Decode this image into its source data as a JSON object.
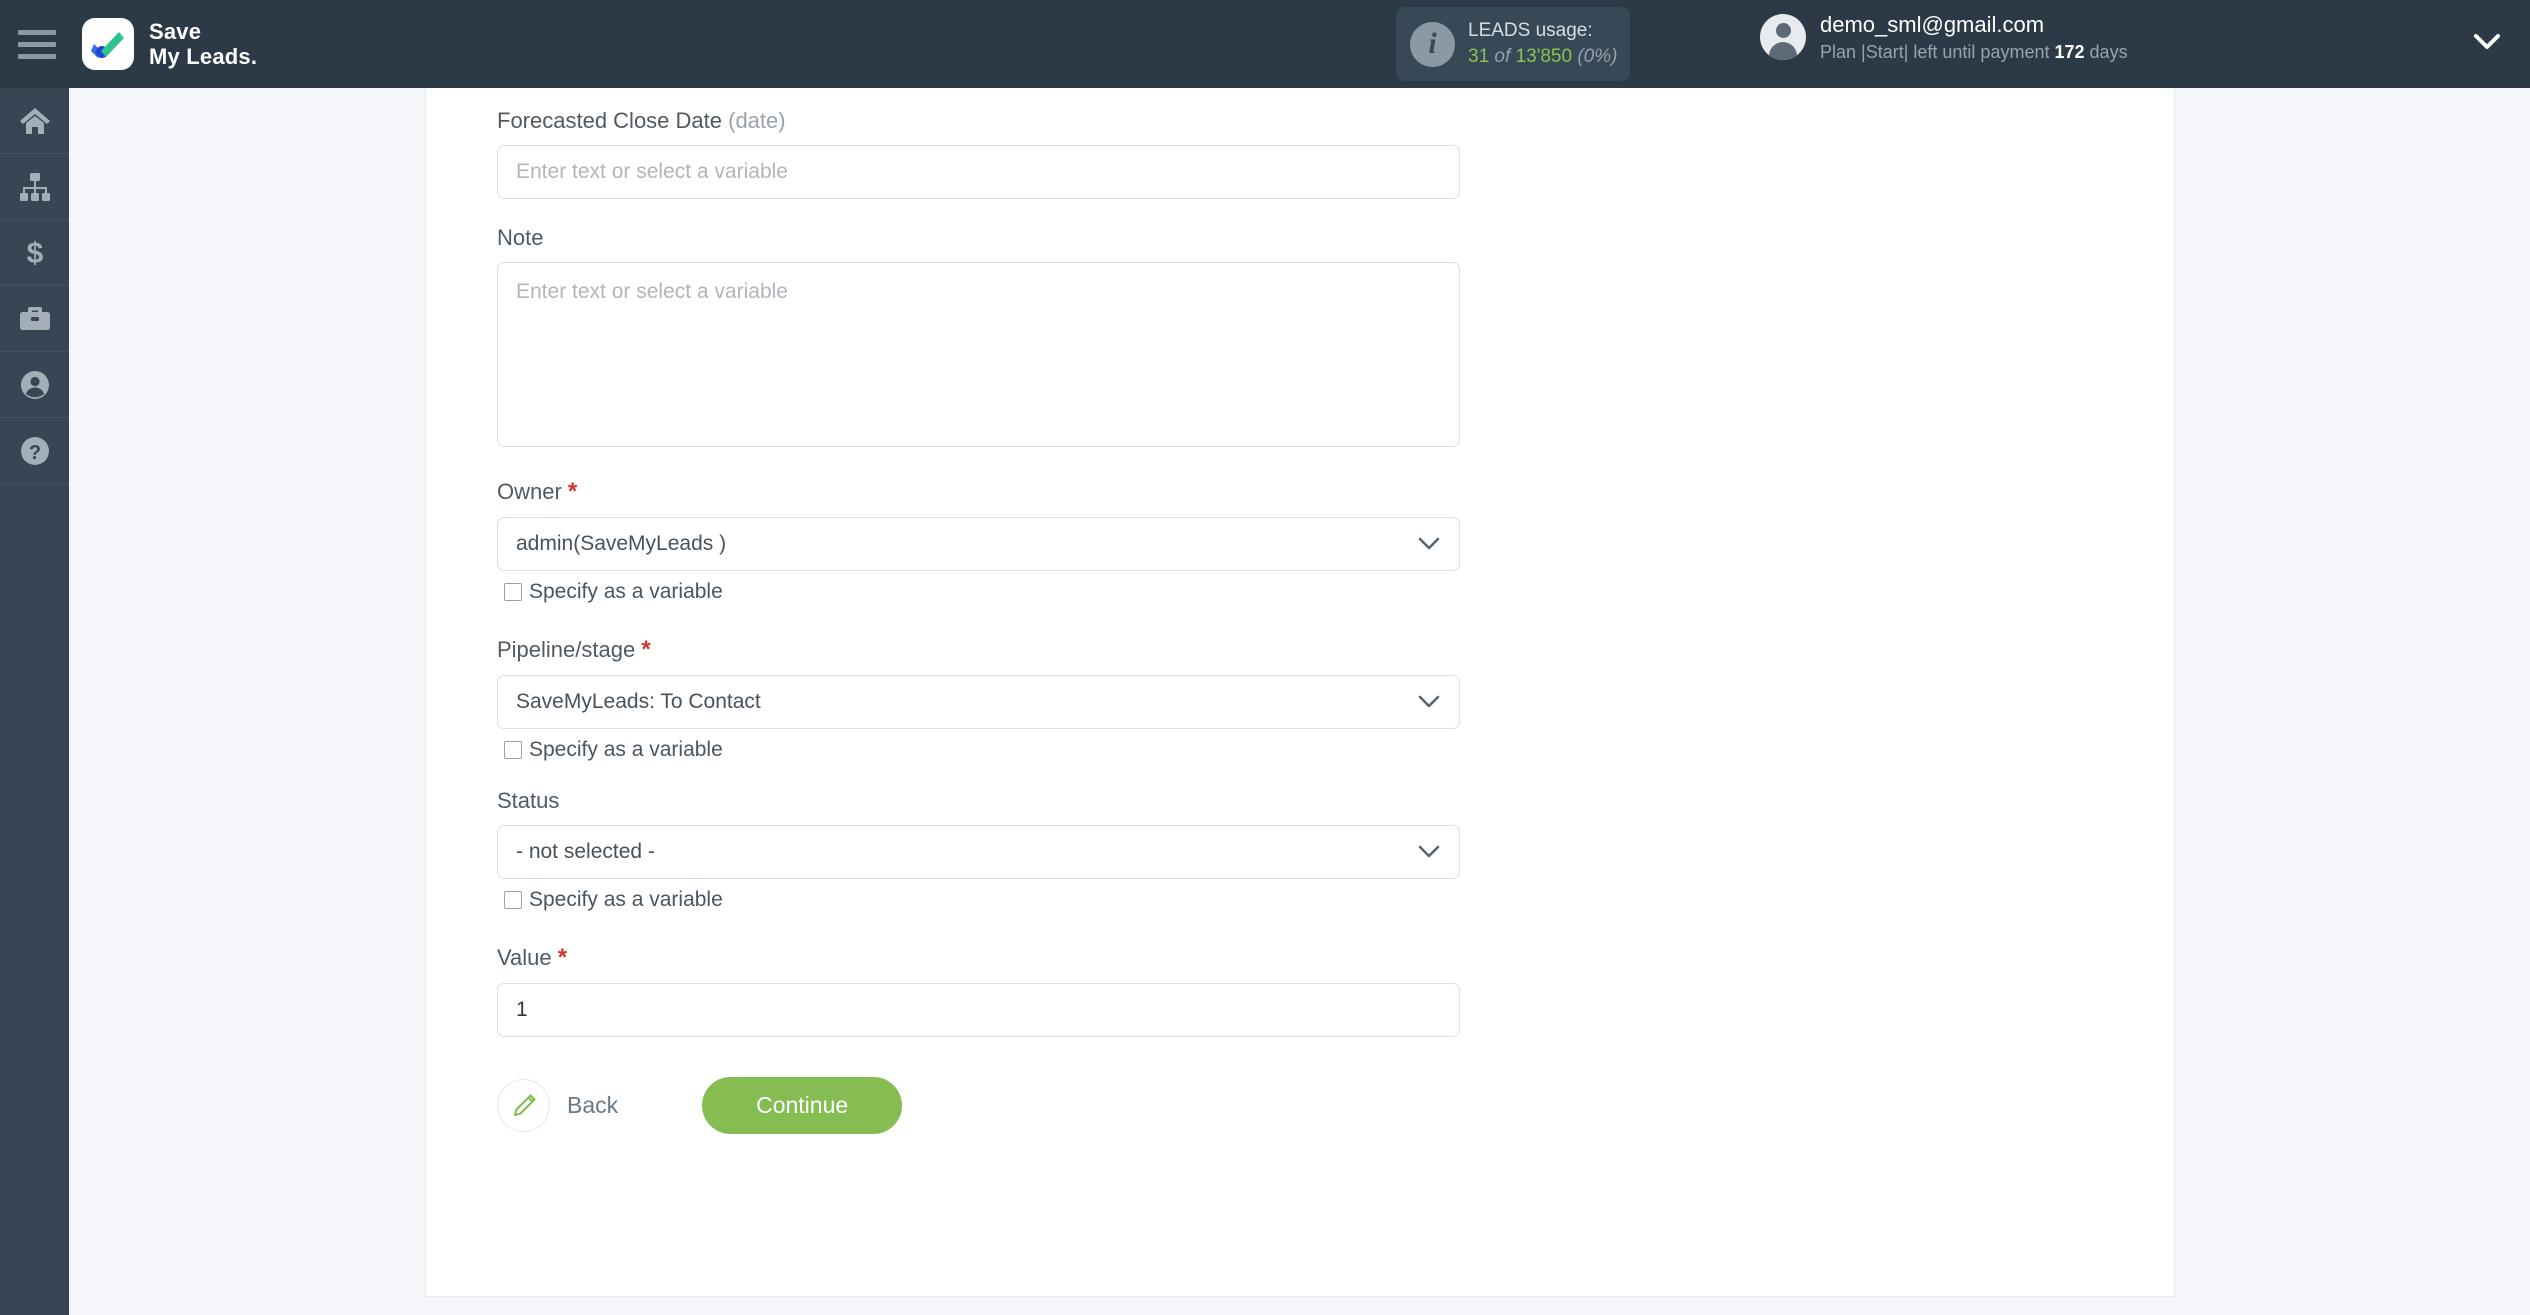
{
  "header": {
    "menu_icon": "hamburger-icon",
    "brand_line1": "Save",
    "brand_line2": "My Leads.",
    "usage": {
      "info_icon": "info-icon",
      "title": "LEADS usage:",
      "used": "31",
      "of": "of",
      "total": "13'850",
      "percent": "(0%)",
      "accent_color": "#8cc152"
    },
    "account": {
      "avatar_icon": "user-avatar-icon",
      "email": "demo_sml@gmail.com",
      "plan_prefix": "Plan |Start| left until payment",
      "plan_days": "172",
      "plan_suffix": "days",
      "caret_icon": "chevron-down-icon"
    }
  },
  "sidebar": {
    "items": [
      {
        "icon": "home-icon",
        "name": "sidebar-item-home"
      },
      {
        "icon": "connections-icon",
        "name": "sidebar-item-connections"
      },
      {
        "icon": "dollar-icon",
        "name": "sidebar-item-billing"
      },
      {
        "icon": "briefcase-icon",
        "name": "sidebar-item-services"
      },
      {
        "icon": "user-icon",
        "name": "sidebar-item-profile"
      },
      {
        "icon": "help-icon",
        "name": "sidebar-item-help"
      }
    ]
  },
  "form": {
    "placeholder": "Enter text or select a variable",
    "checkbox_label": "Specify as a variable",
    "forecasted_close_date": {
      "label": "Forecasted Close Date",
      "type_hint": "(date)",
      "value": ""
    },
    "note": {
      "label": "Note",
      "value": ""
    },
    "owner": {
      "label": "Owner",
      "required": "*",
      "value": "admin(SaveMyLeads )"
    },
    "pipeline_stage": {
      "label": "Pipeline/stage",
      "required": "*",
      "value": "SaveMyLeads: To Contact"
    },
    "status": {
      "label": "Status",
      "value": "- not selected -"
    },
    "value_field": {
      "label": "Value",
      "required": "*",
      "value": "1"
    }
  },
  "actions": {
    "back_label": "Back",
    "back_icon": "pencil-icon",
    "continue_label": "Continue",
    "continue_color": "#85bd52"
  }
}
